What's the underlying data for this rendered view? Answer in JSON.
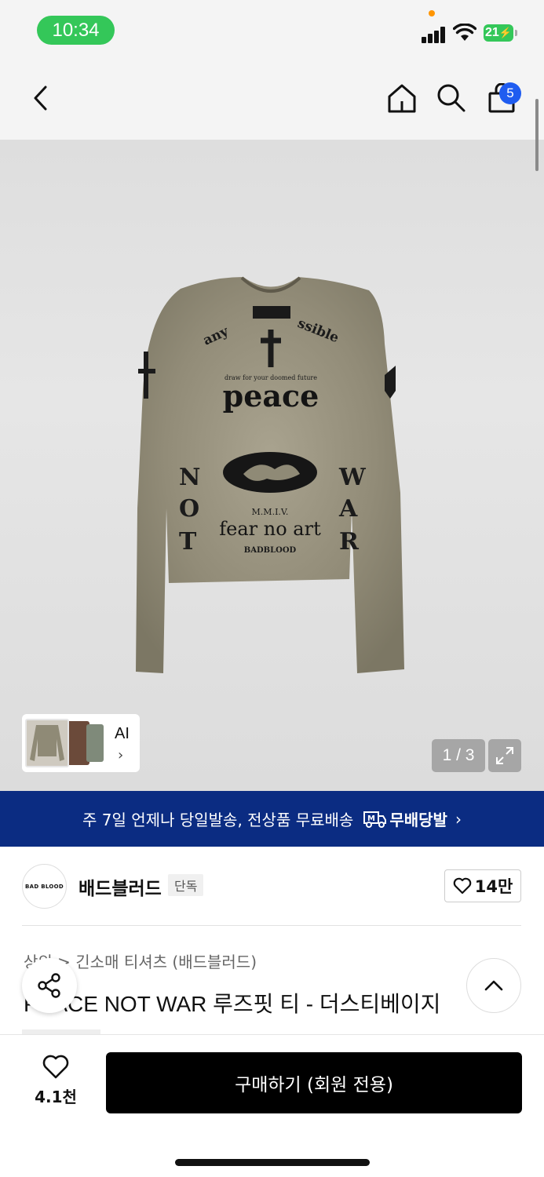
{
  "status": {
    "time": "10:34",
    "battery": "21"
  },
  "header": {
    "cart_count": "5"
  },
  "gallery": {
    "ai_label": "AI",
    "counter": "1 / 3",
    "shirt_print": {
      "arc_left": "any",
      "arc_right": "ssible",
      "small_line": "draw for your doomed future",
      "peace": "peace",
      "mmiv": "M.M.I.V.",
      "fear": "fear no art",
      "brand": "BADBLOOD",
      "left_col": [
        "N",
        "O",
        "T"
      ],
      "right_col": [
        "W",
        "A",
        "R"
      ]
    }
  },
  "banner": {
    "text": "주 7일 언제나 당일발송, 전상품 무료배송",
    "logo_mark": "M",
    "logo_text": "무배당발"
  },
  "brand": {
    "logo_text": "BAD BLOOD",
    "name": "배드블러드",
    "badge": "단독",
    "likes": "14만"
  },
  "product": {
    "category": "상의 > 긴소매 티셔츠 (배드블러드)",
    "title": "PEACE NOT WAR 루즈핏 티 - 더스티베이지"
  },
  "bottom_bar": {
    "wish_count": "4.1천",
    "buy_label": "구매하기 (회원 전용)"
  },
  "colors": {
    "status_green": "#34c759",
    "badge_blue": "#1f5cf0",
    "banner_navy": "#0b2c82",
    "buy_black": "#000000"
  }
}
